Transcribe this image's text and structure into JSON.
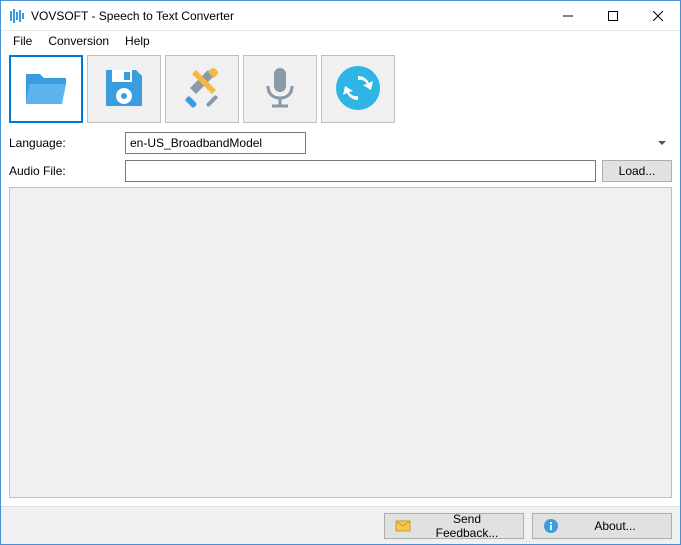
{
  "window": {
    "title": "VOVSOFT - Speech to Text Converter"
  },
  "menu": {
    "file": "File",
    "conversion": "Conversion",
    "help": "Help"
  },
  "toolbar": {
    "open": "open",
    "save": "save",
    "settings": "settings",
    "record": "record",
    "convert": "convert"
  },
  "form": {
    "language_label": "Language:",
    "language_value": "en-US_BroadbandModel",
    "audio_label": "Audio File:",
    "audio_value": "",
    "load_label": "Load..."
  },
  "output": {
    "text": ""
  },
  "footer": {
    "feedback": "Send Feedback...",
    "about": "About..."
  },
  "colors": {
    "accent": "#0078d7",
    "icon_blue": "#3a9de0",
    "icon_gray": "#8a99a8",
    "icon_cyan": "#2fb4e6"
  }
}
